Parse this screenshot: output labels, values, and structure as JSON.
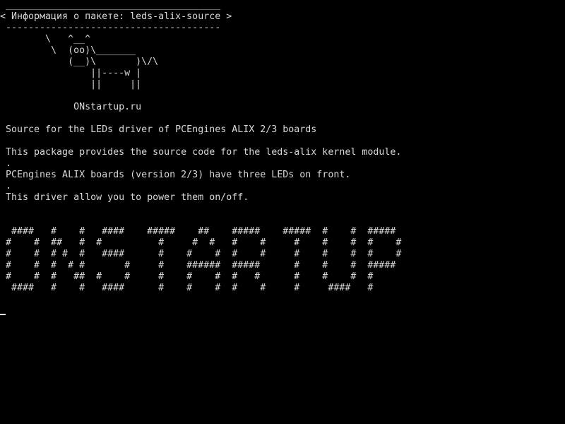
{
  "terminal": {
    "bubble": {
      "top_border": " ______________________________________",
      "title_line": "< Информация о пакете: leds-alix-source >",
      "bottom_border": " --------------------------------------"
    },
    "cow": [
      "        \\   ^__^",
      "         \\  (oo)\\_______",
      "            (__)\\       )\\/\\",
      "                ||----w |",
      "                ||     ||"
    ],
    "site": "             ONstartup.ru",
    "description": {
      "summary": " Source for the LEDs driver of PCEngines ALIX 2/3 boards",
      "para1": " This package provides the source code for the leds-alix kernel module.",
      "sep1": " .",
      "para2": " PCEngines ALIX boards (version 2/3) have three LEDs on front.",
      "sep2": " .",
      "para3": " This driver allow you to power them on/off."
    },
    "banner": [
      "  ####   #    #   ####    #####    ##    #####    #####  #    #  #####",
      " #    #  ##   #  #          #     #  #   #    #     #    #    #  #    #",
      " #    #  # #  #   ####      #    #    #  #    #     #    #    #  #    #",
      " #    #  #  # #       #     #    ######  #####      #    #    #  #####",
      " #    #  #   ##  #    #     #    #    #  #   #      #    #    #  #",
      "  ####   #    #   ####      #    #    #  #    #     #     ####   #"
    ]
  }
}
